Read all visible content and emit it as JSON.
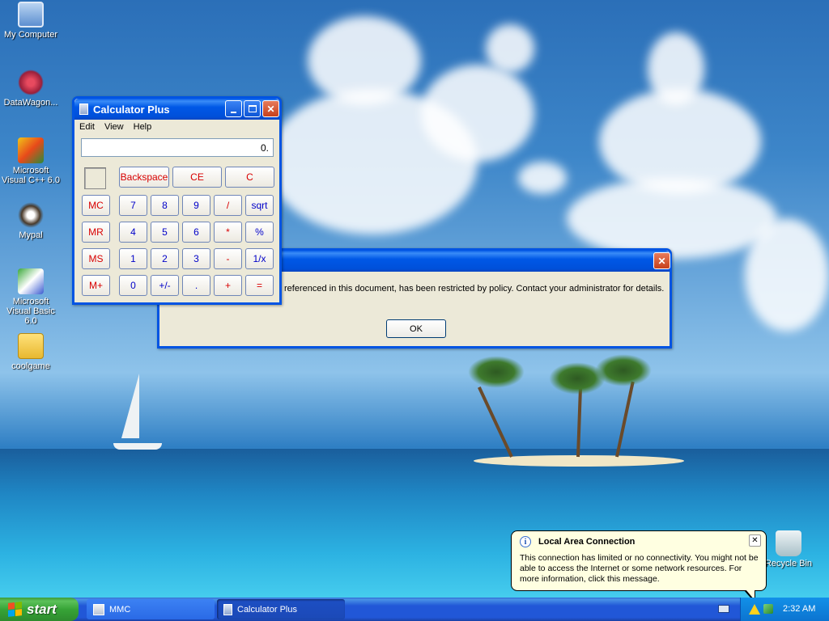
{
  "desktop": {
    "icons": [
      {
        "label": "My Computer"
      },
      {
        "label": "DataWagon..."
      },
      {
        "label": "Microsoft Visual C++ 6.0"
      },
      {
        "label": "Mypal"
      },
      {
        "label": "Microsoft Visual Basic 6.0"
      },
      {
        "label": "coolgame"
      },
      {
        "label": "Recycle Bin"
      }
    ]
  },
  "calculator": {
    "title": "Calculator Plus",
    "menu": [
      "Edit",
      "View",
      "Help"
    ],
    "display": "0.",
    "top_row": [
      "Backspace",
      "CE",
      "C"
    ],
    "memory_keys": [
      "MC",
      "MR",
      "MS",
      "M+"
    ],
    "keys": [
      [
        "7",
        "8",
        "9",
        "/",
        "sqrt"
      ],
      [
        "4",
        "5",
        "6",
        "*",
        "%"
      ],
      [
        "1",
        "2",
        "3",
        "-",
        "1/x"
      ],
      [
        "0",
        "+/-",
        ".",
        "+",
        "="
      ]
    ]
  },
  "dialog": {
    "message": "referenced in this document, has been restricted by policy. Contact your administrator for details.",
    "ok_label": "OK"
  },
  "balloon": {
    "title": "Local Area Connection",
    "body": "This connection has limited or no connectivity. You might not be able to access the Internet or some network resources. For more information, click this message."
  },
  "taskbar": {
    "start_label": "start",
    "tasks": [
      {
        "label": "MMC"
      },
      {
        "label": "Calculator Plus"
      }
    ],
    "clock": "2:32 AM"
  },
  "colors": {
    "title_blue": "#0054e3",
    "start_green": "#37a437",
    "calc_red_key": "#d80000",
    "calc_blue_key": "#0000c8",
    "balloon_bg": "#ffffe1"
  }
}
